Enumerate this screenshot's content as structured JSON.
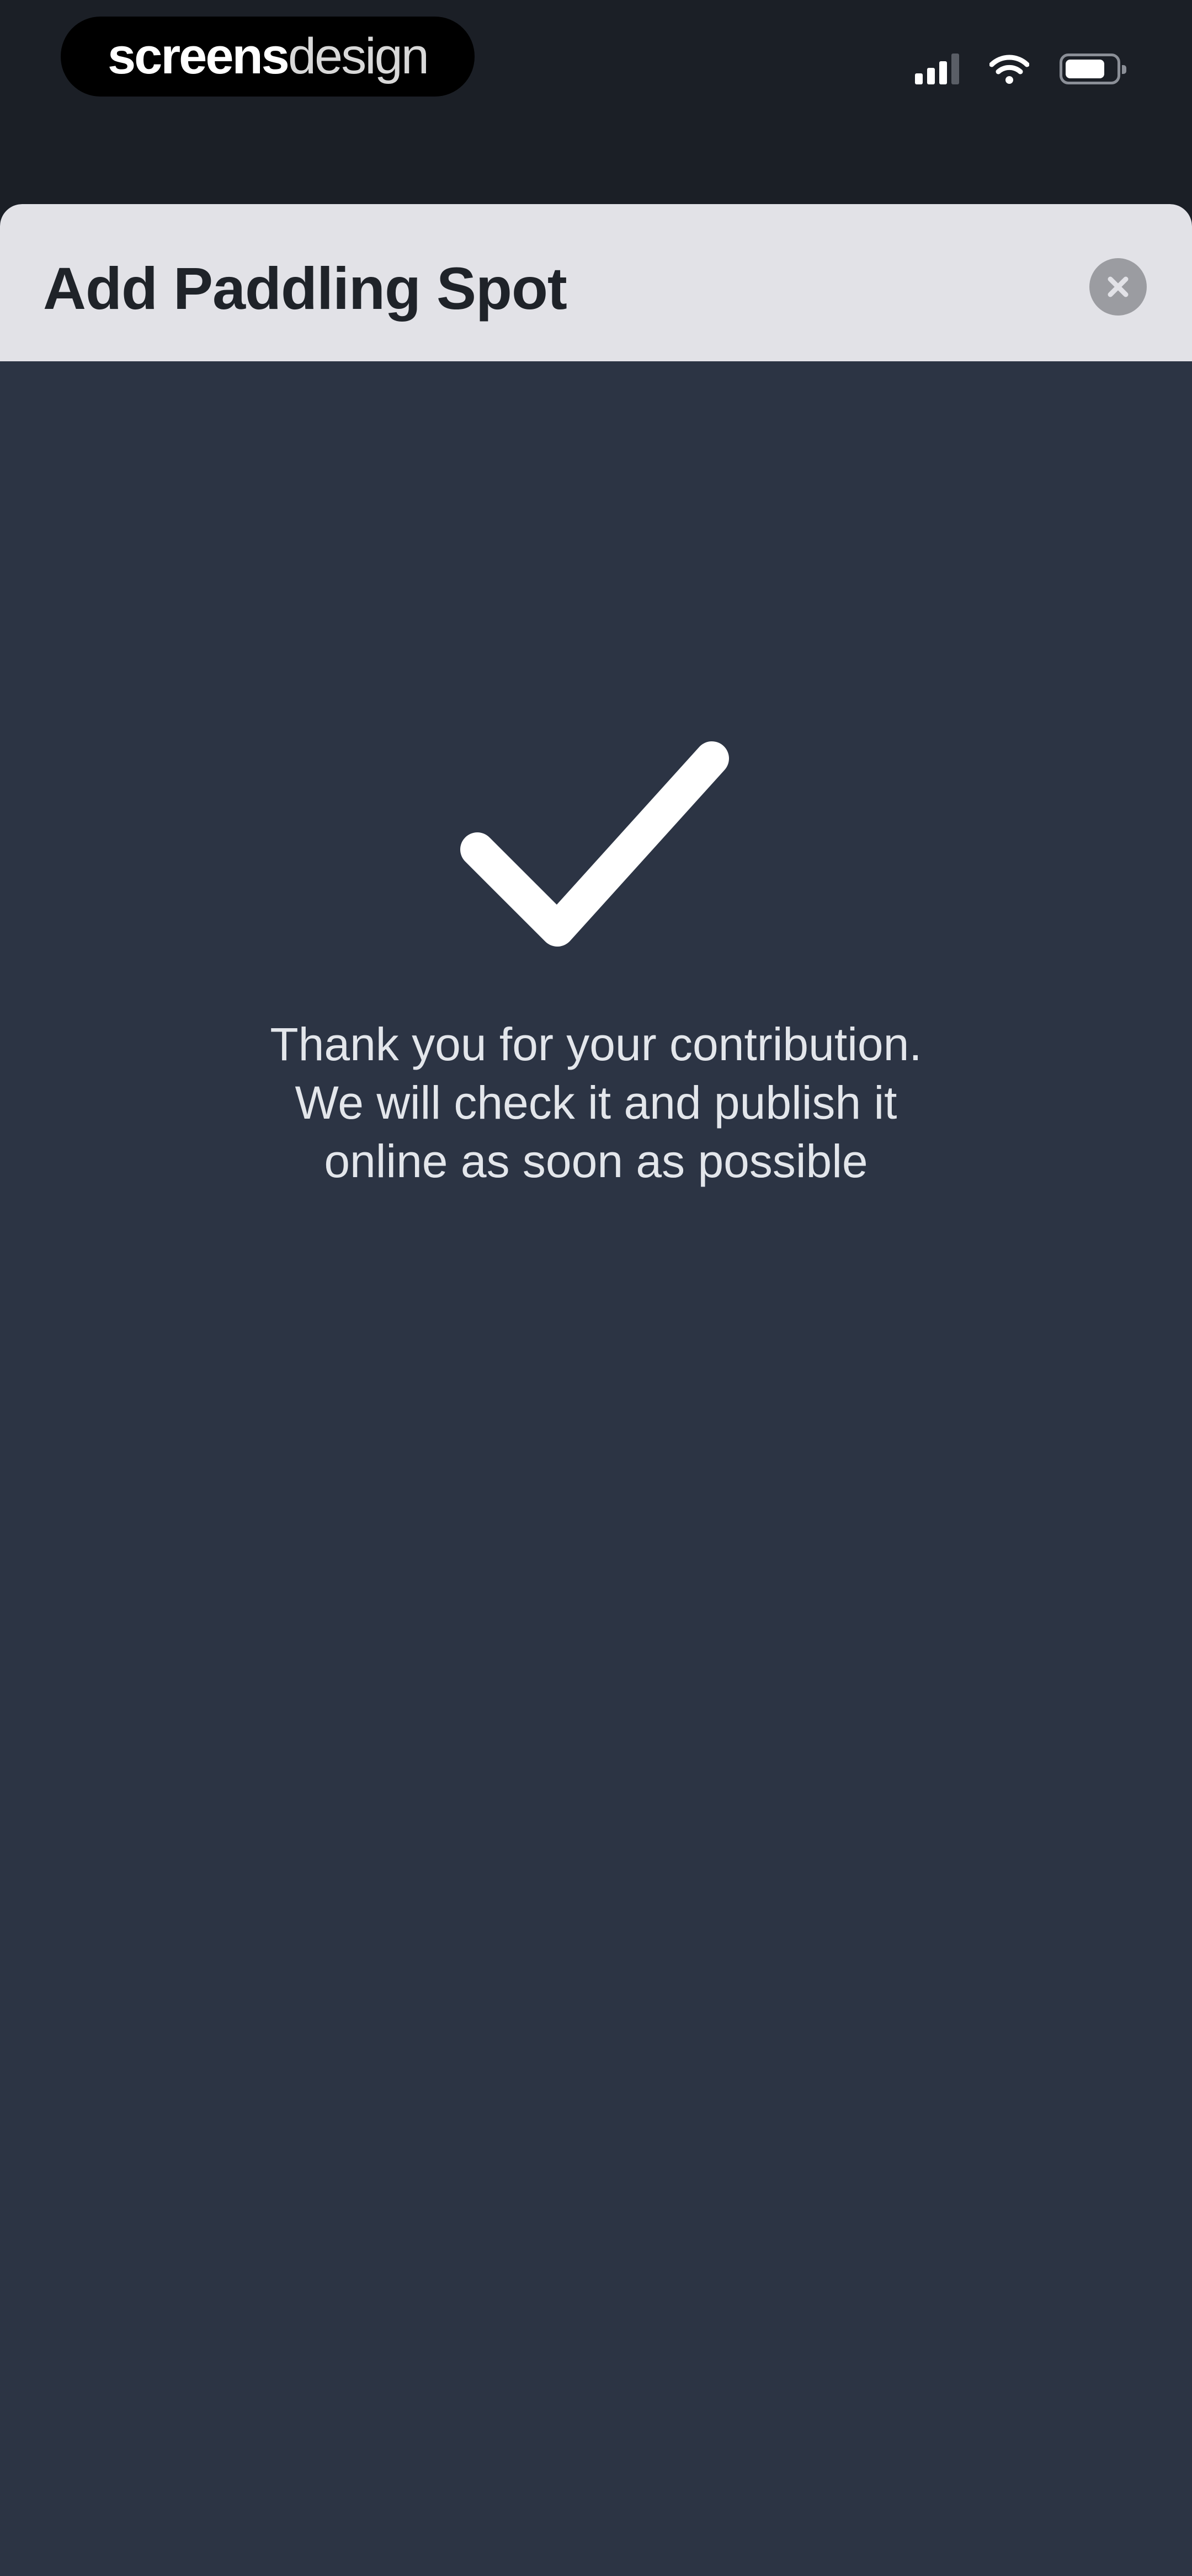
{
  "status_bar": {
    "brand_left": "screens",
    "brand_right": "design",
    "icons": [
      "signal-icon",
      "wifi-icon",
      "battery-icon"
    ]
  },
  "sheet": {
    "title": "Add Paddling Spot",
    "close_icon": "close-icon"
  },
  "confirmation": {
    "icon": "checkmark-icon",
    "message_lines": [
      "Thank you for your contribution.",
      "We will check it and publish it",
      "online as soon as possible"
    ]
  },
  "colors": {
    "header_background": "#e2e2e7",
    "content_background": "#2c3444",
    "status_background": "#1b1f26",
    "text_light": "#e3e6eb",
    "text_dark": "#1f2329"
  }
}
